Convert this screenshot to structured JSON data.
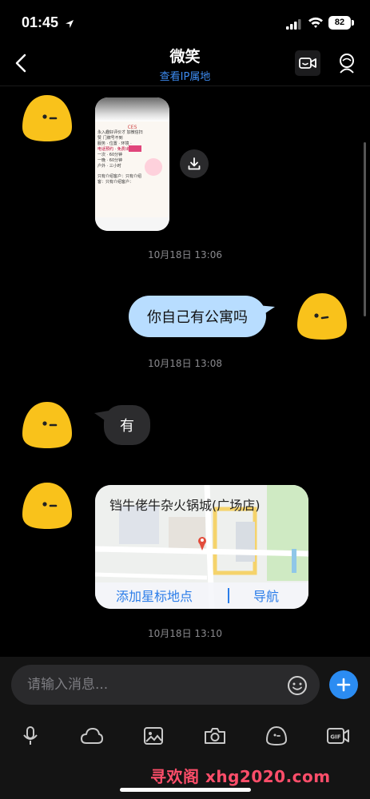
{
  "status": {
    "time": "01:45",
    "battery": "82"
  },
  "header": {
    "title": "微笑",
    "subtitle": "查看IP属地"
  },
  "messages": {
    "image_text": [
      "CES",
      "永入趣好评价才 加微信扫",
      "赞 门牌号不到",
      "服务 · 位置 · 环境 ·",
      "电话预约 · 免费出行",
      "一次 · 60分钟",
      "一晚 · 60分钟",
      "户外 · 三小时",
      "只有介绍客户：只有介绍",
      "客：只有介绍客户："
    ],
    "timestamp1": "10月18日 13:06",
    "outgoing_text": "你自己有公寓吗",
    "timestamp2": "10月18日 13:08",
    "incoming_text": "有",
    "map": {
      "title": "铛牛佬牛杂火锅城(广场店)",
      "add_label": "添加星标地点",
      "nav_label": "导航"
    },
    "timestamp3": "10月18日 13:10"
  },
  "input": {
    "placeholder": "请输入消息..."
  },
  "watermark": "寻欢阁 xhg2020.com",
  "colors": {
    "accent": "#2b8cf2",
    "outgoing_bubble": "#b8ddff",
    "incoming_bubble": "#2c2c2e",
    "avatar": "#f9c21b"
  }
}
